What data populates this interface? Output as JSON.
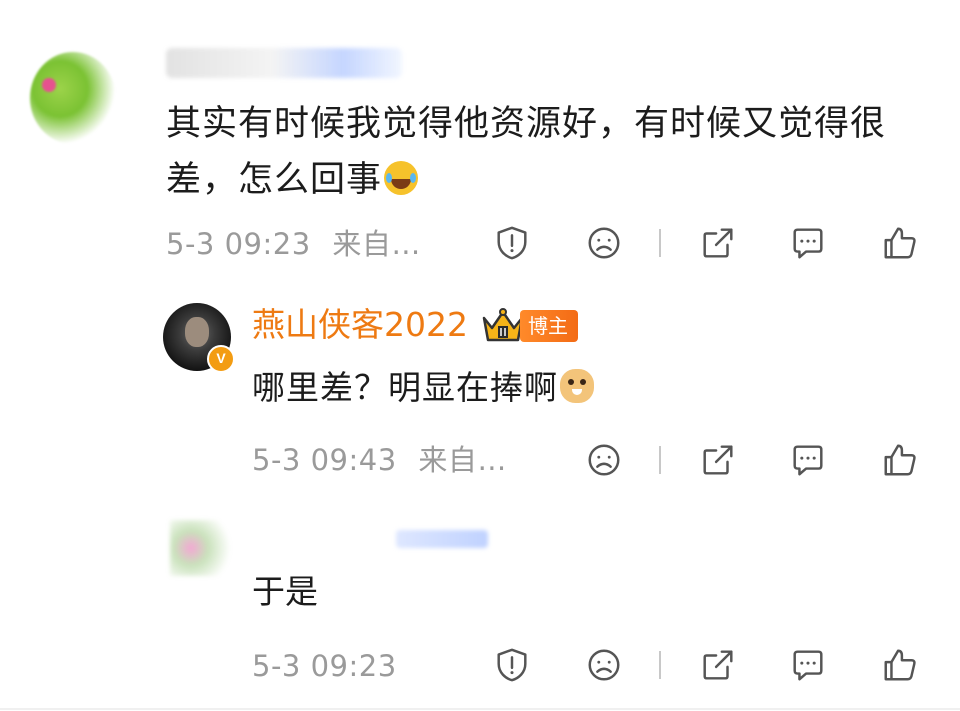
{
  "comments": [
    {
      "text": "其实有时候我觉得他资源好，有时候又觉得很差，怎么回事",
      "emoji": "laugh-cry-emoji",
      "timestamp": "5-3 09:23",
      "source": "来自…"
    }
  ],
  "reply": {
    "author": "燕山侠客2022",
    "badge": "博主",
    "verified_mark": "V",
    "text": "哪里差？明显在捧啊",
    "emoji": "doge-emoji",
    "timestamp": "5-3 09:43",
    "source": "来自…"
  },
  "third": {
    "text": "于是",
    "timestamp": "5-3 09:23"
  },
  "colors": {
    "author_orange": "#ee7a12",
    "meta_gray": "#9a9a9a",
    "text": "#1c1c1c"
  },
  "icons": [
    "report-icon",
    "dislike-face-icon",
    "share-icon",
    "comment-icon",
    "like-thumb-icon"
  ]
}
